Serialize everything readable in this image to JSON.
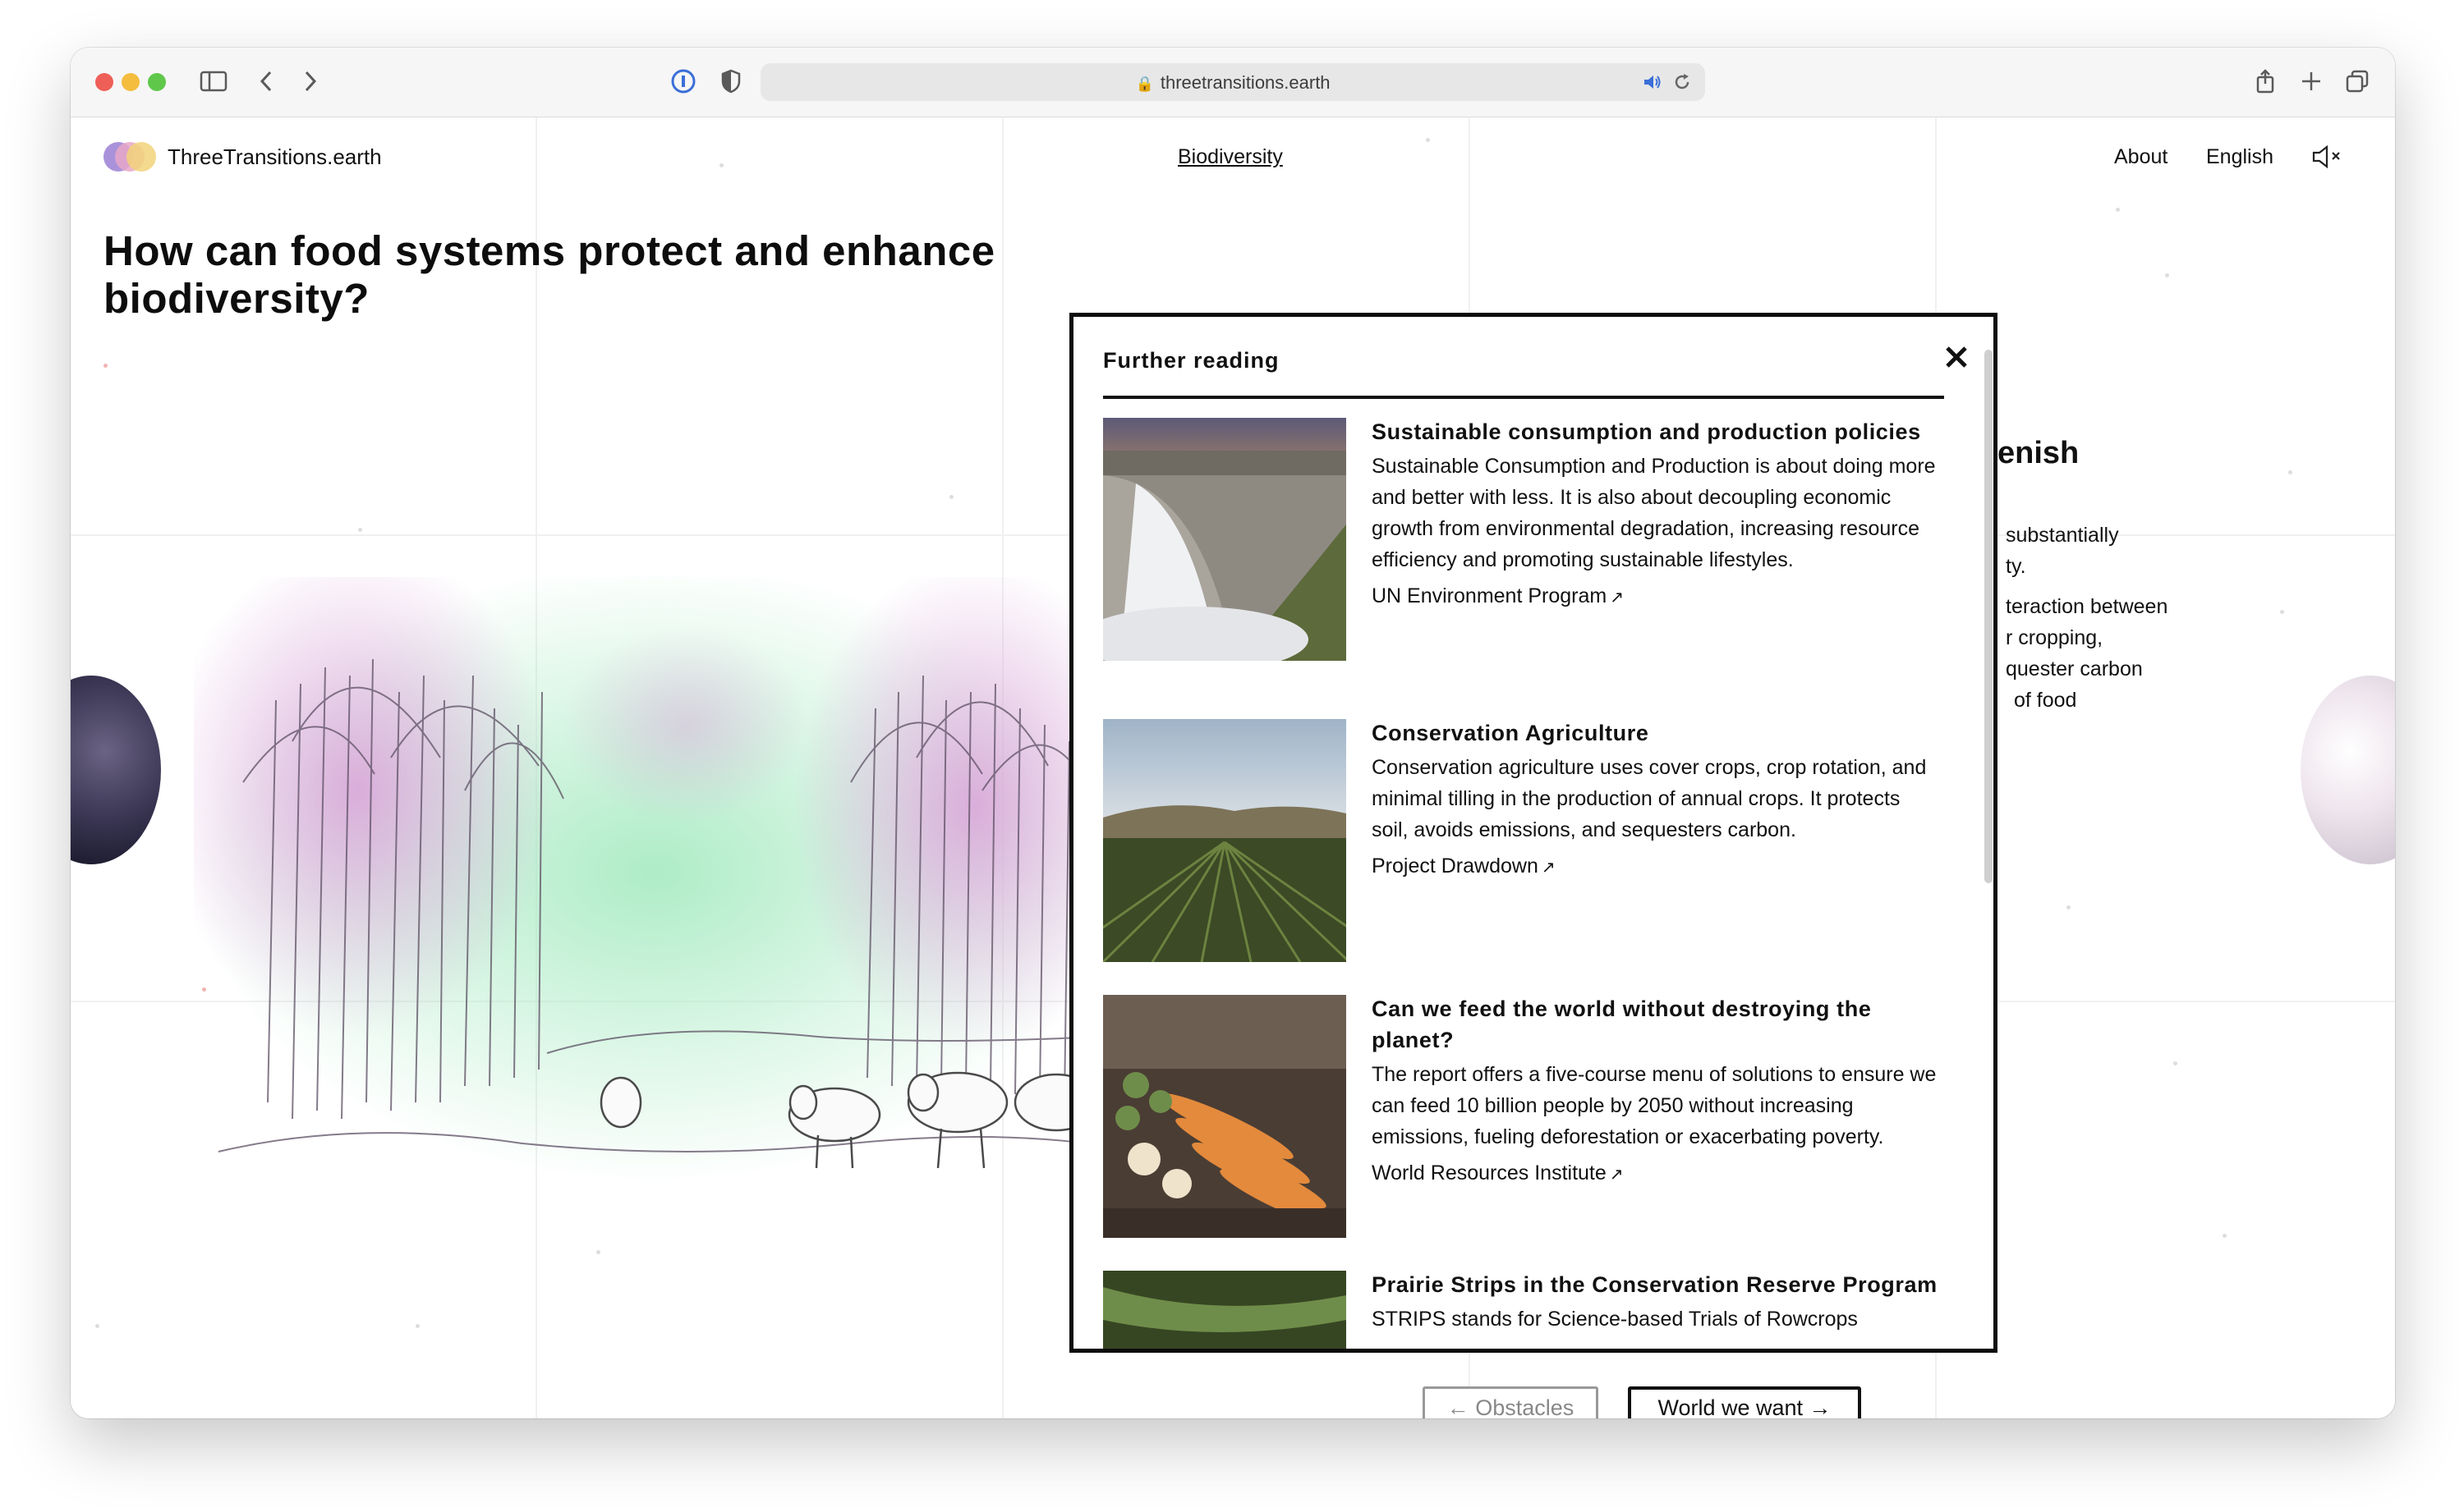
{
  "browser": {
    "url": "threetransitions.earth"
  },
  "header": {
    "logo_text": "ThreeTransitions.earth",
    "section_link": "Biodiversity",
    "about_label": "About",
    "language_label": "English"
  },
  "hero": {
    "title": "How can food systems protect and enhance biodiversity?"
  },
  "background_text": {
    "heading_fragment": "enish",
    "lines_a": [
      "substantially",
      "ty."
    ],
    "lines_b": [
      "teraction between",
      "r cropping,",
      "quester carbon",
      "of food"
    ]
  },
  "modal": {
    "title": "Further reading",
    "items": [
      {
        "title": "Sustainable consumption and production policies",
        "description": "Sustainable Consumption and Production is about doing more and better with less. It is also about decoupling economic growth from environmental degradation, increasing resource efficiency and promoting sustainable lifestyles.",
        "source": "UN Environment Program"
      },
      {
        "title": "Conservation Agriculture",
        "description": "Conservation agriculture uses cover crops, crop rotation, and minimal tilling in the production of annual crops. It protects soil, avoids emissions, and sequesters carbon.",
        "source": "Project Drawdown"
      },
      {
        "title": "Can we feed the world without destroying the planet?",
        "description": "The report offers a five-course menu of solutions to ensure we can feed 10 billion people by 2050 without increasing emissions, fueling deforestation or exacerbating poverty.",
        "source": "World Resources Institute"
      },
      {
        "title": "Prairie Strips in the Conservation Reserve Program",
        "description": "STRIPS stands for Science-based Trials of Rowcrops"
      }
    ]
  },
  "navigation": {
    "prev_label": "← Obstacles",
    "next_label": "World we want →"
  },
  "colors": {
    "modal_border": "#0d0d0d",
    "logo_purple": "#9b7fd4",
    "logo_yellow": "#f2d37a",
    "logo_pink": "#e8a7c8"
  }
}
